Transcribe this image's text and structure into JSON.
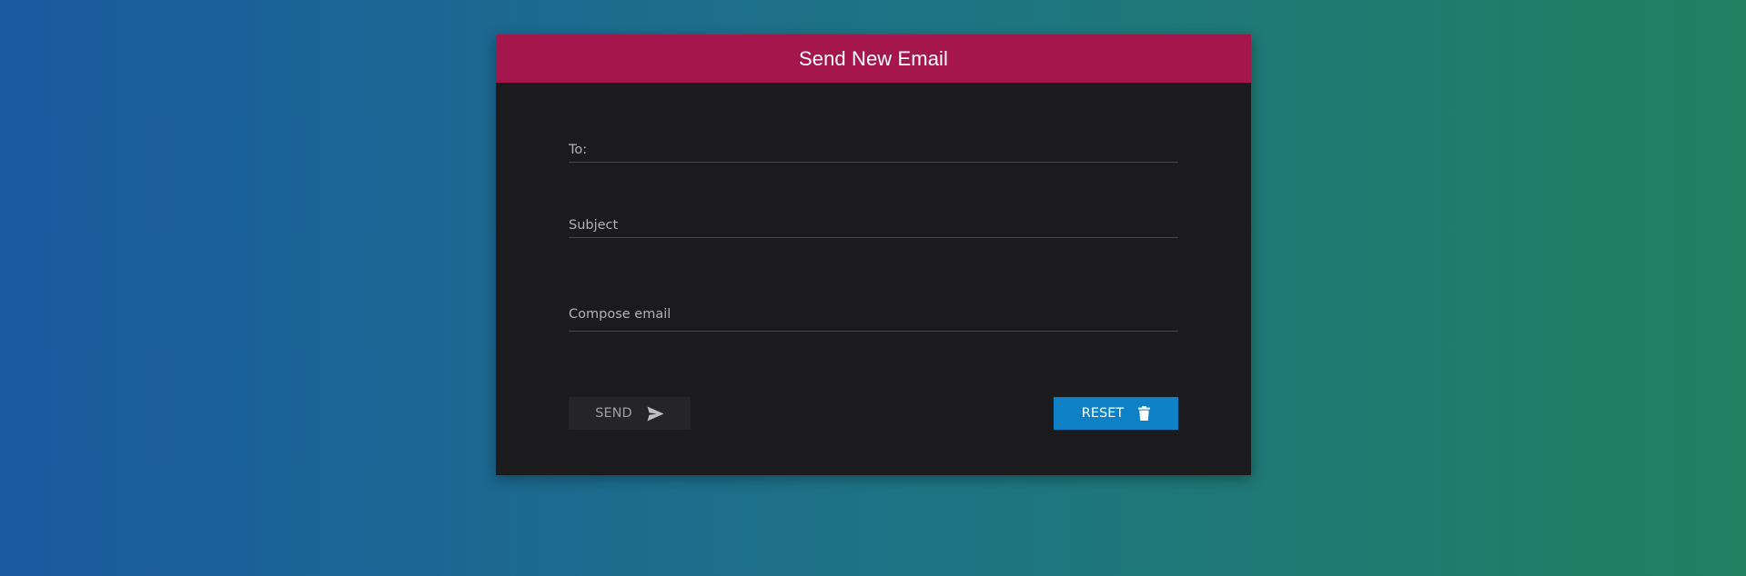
{
  "form": {
    "title": "Send New Email",
    "to_placeholder": "To:",
    "subject_placeholder": "Subject",
    "compose_placeholder": "Compose email",
    "send_label": "SEND",
    "reset_label": "RESET",
    "send_icon": "send-icon",
    "reset_icon": "trash-icon"
  },
  "colors": {
    "header": "#a5174c",
    "card": "#1b1b1d",
    "reset_button": "#0d80c6",
    "send_button": "#252527"
  }
}
